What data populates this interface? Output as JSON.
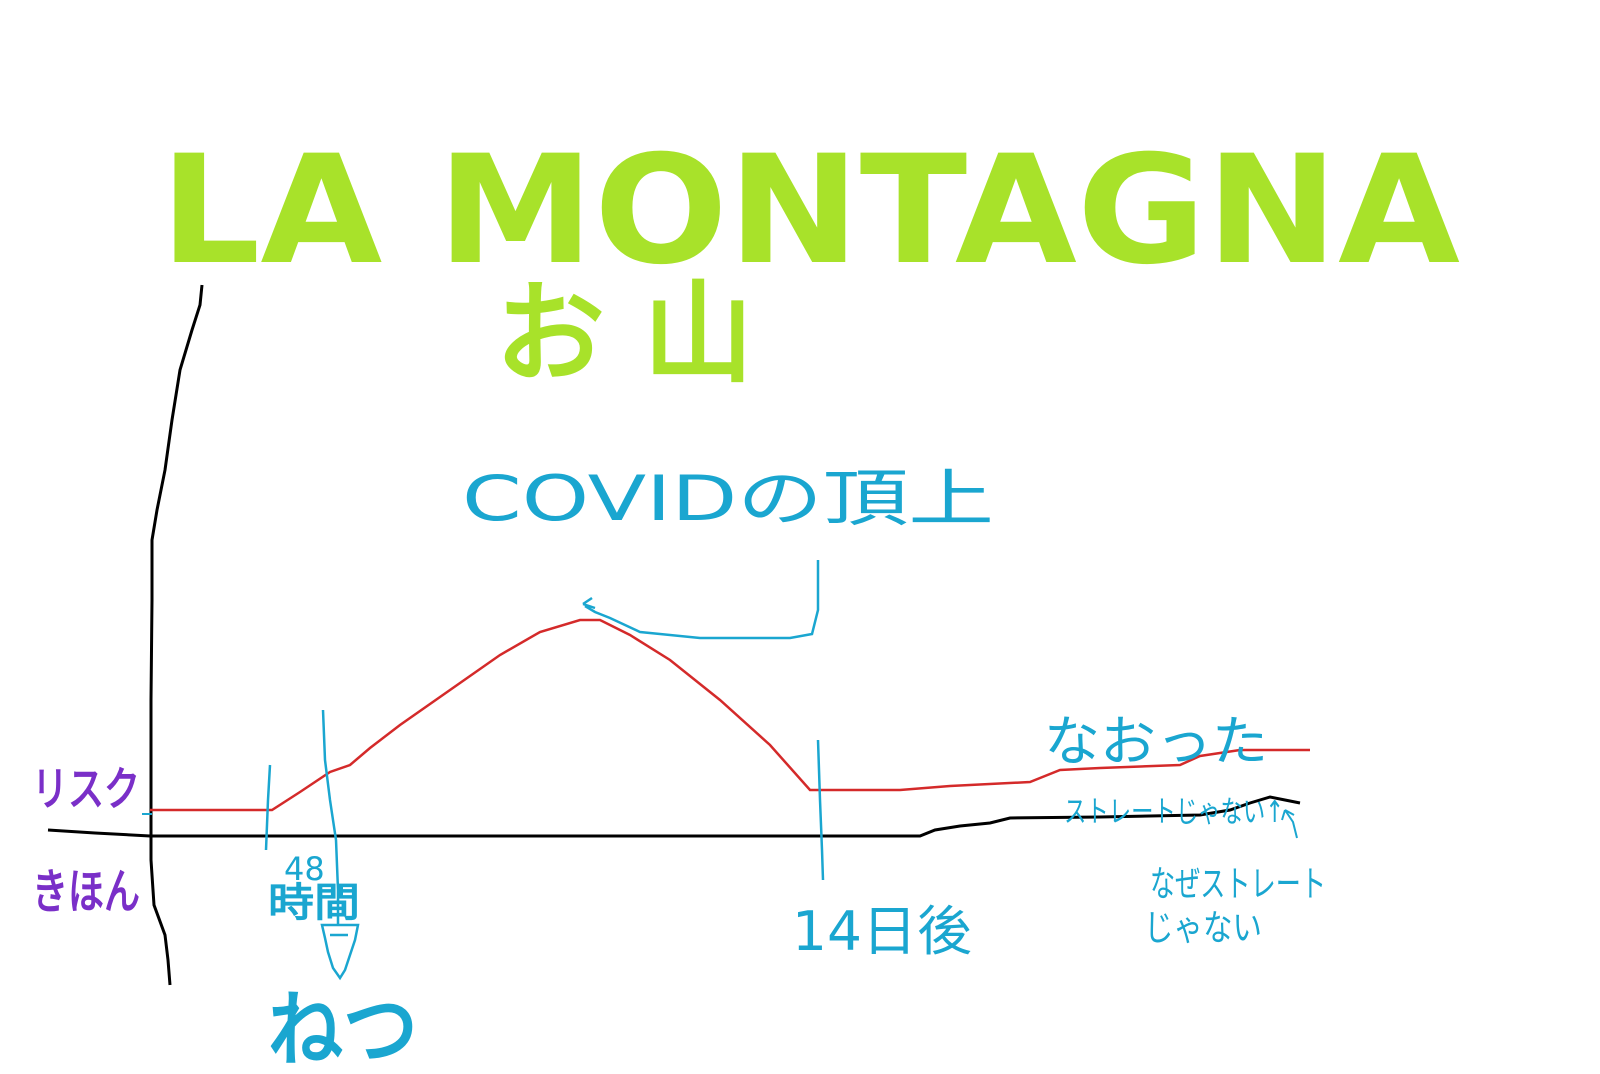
{
  "title": "LA MONTAGNA",
  "subtitle": "お 山",
  "peak_label": "COVIDの頂上",
  "labels": {
    "risk": "リスク",
    "baseline": "きほん",
    "hours_number": "48",
    "hours_unit": "時間",
    "sleep": "ねつ",
    "days": "14日後",
    "recovered": "なおった",
    "not_straight": "ストレートじゃない↑",
    "why_line1": "なぜストレート",
    "why_line2": "じゃない"
  },
  "colors": {
    "title": "#a8e22a",
    "annotation": "#1aa6d0",
    "axis_label": "#7a2fc8",
    "risk_line": "#d42a2a",
    "baseline_line": "#000000"
  }
}
